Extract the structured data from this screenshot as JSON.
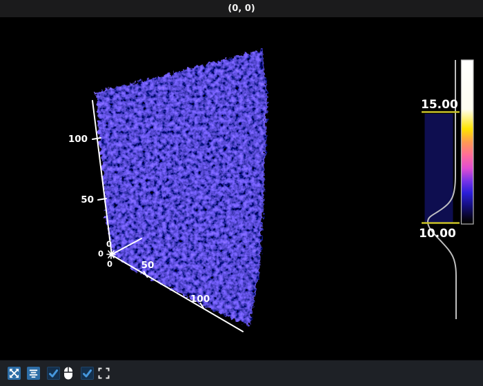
{
  "window": {
    "title": "(0, 0)"
  },
  "scene": {
    "axis_color": "#ffffff",
    "volume_base_color": "#1515cc",
    "y_axis_ticks": [
      "100",
      "50"
    ],
    "x_axis_ticks": [
      "50",
      "100"
    ],
    "origin_labels": [
      "0",
      "0",
      "0"
    ]
  },
  "transfer_function": {
    "upper_value": "15.00",
    "lower_value": "10.00",
    "threshold_line_color": "#c9c127",
    "histogram_box_color": "#0e0e50",
    "curve_color": "#c9c9c9",
    "colorbar_gradient": [
      "#ffffff",
      "#fffef0",
      "#ffe400",
      "#ff9a52",
      "#ff6d9a",
      "#e14ed2",
      "#7433e8",
      "#2b1ed9",
      "#140f7a",
      "#000000"
    ]
  },
  "toolbar": {
    "accent_color": "#2d6da6",
    "check_color": "#4697dc",
    "buttons": [
      {
        "id": "pan",
        "icon": "move-arrows-icon",
        "type": "button"
      },
      {
        "id": "center",
        "icon": "align-center-icon",
        "type": "button"
      },
      {
        "id": "toggle-1",
        "icon": "checkbox-checked-icon",
        "type": "checkbox",
        "checked": true
      },
      {
        "id": "mouse-mode",
        "icon": "mouse-icon",
        "type": "indicator"
      },
      {
        "id": "toggle-2",
        "icon": "checkbox-checked-icon",
        "type": "checkbox",
        "checked": true
      },
      {
        "id": "fullscreen",
        "icon": "fullscreen-icon",
        "type": "button"
      }
    ]
  }
}
